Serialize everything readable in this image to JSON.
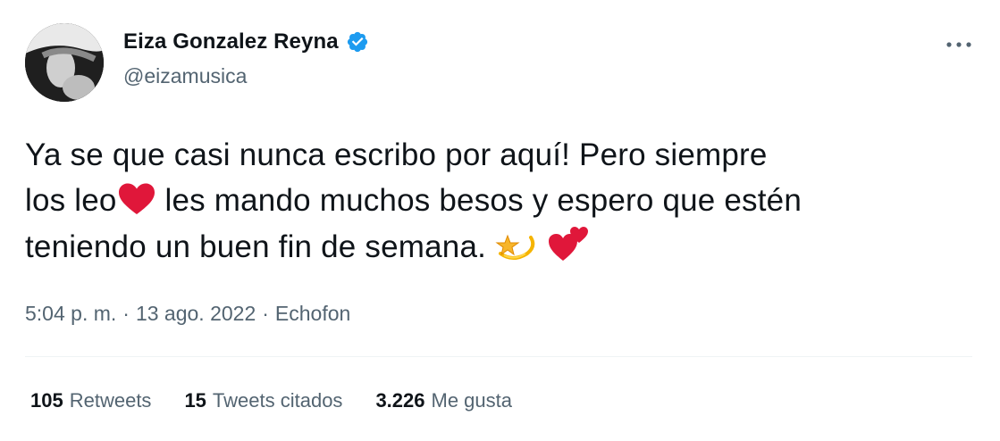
{
  "tweet": {
    "author": {
      "display_name": "Eiza Gonzalez Reyna",
      "handle": "@eizamusica",
      "verified": true
    },
    "text_lines": [
      "Ya se que casi nunca escribo por aquí! Pero siempre",
      "los leo",
      " les mando muchos besos y espero que estén",
      "teniendo un buen fin de semana. "
    ],
    "emojis": [
      "red-heart",
      "dizzy-star",
      "two-hearts"
    ],
    "meta": {
      "time": "5:04 p. m.",
      "separator": "·",
      "date": "13 ago. 2022",
      "source": "Echofon"
    },
    "stats": {
      "retweets_count": "105",
      "retweets_label": "Retweets",
      "quotes_count": "15",
      "quotes_label": "Tweets citados",
      "likes_count": "3.226",
      "likes_label": "Me gusta"
    }
  },
  "colors": {
    "text_primary": "#0f1419",
    "text_secondary": "#536471",
    "verified_blue": "#1d9bf0",
    "divider": "#eff3f4",
    "heart_red": "#e0173a"
  }
}
